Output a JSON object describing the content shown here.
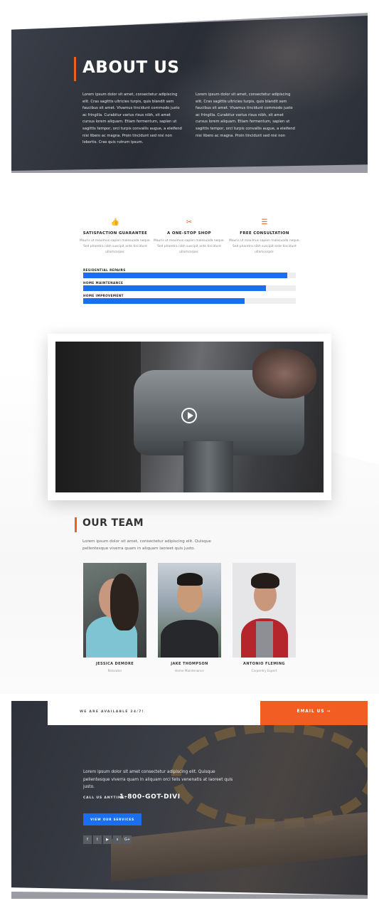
{
  "hero": {
    "title": "ABOUT US",
    "col1": "Lorem ipsum dolor sit amet, consectetur adipiscing elit. Cras sagittis ultricies turpis, quis blandit sem faucibus sit amet. Vivamus tincidunt commodo justo ac fringilla. Curabitur varius risus nibh, sit amet cursus lorem aliquam. Etiam fermentum, sapien ut sagittis tempor, orci turpis convallis augue, a eleifend nisi libero ac magna. Proin tincidunt sed nisi non lobortis. Cras quis rutrum ipsum.",
    "col2": "Lorem ipsum dolor sit amet, consectetur adipiscing elit. Cras sagittis ultricies turpis, quis blandit sem faucibus sit amet. Vivamus tincidunt commodo justo ac fringilla. Curabitur varius risus nibh, sit amet cursus lorem aliquam. Etiam fermentum, sapien ut sagittis tempor, orci turpis convallis augue, a eleifend nisi libero ac magna. Proin tincidunt sed nisi non"
  },
  "features": [
    {
      "icon": "thumbs-up-icon",
      "glyph": "👍",
      "title": "SATISFACTION GUARANTEE",
      "text": "Mauris ut maximus sapien malesuada neque. Sed pharetra nibh suscipit ante tincidunt ullamcorper."
    },
    {
      "icon": "tools-icon",
      "glyph": "✂",
      "title": "A ONE-STOP SHOP",
      "text": "Mauris ut maximus sapien malesuada neque. Sed pharetra nibh suscipit ante tincidunt ullamcorper."
    },
    {
      "icon": "document-icon",
      "glyph": "☰",
      "title": "FREE CONSULTATION",
      "text": "Mauris ut maximus sapien malesuada neque. Sed pharetra nibh suscipit ante tincidunt ullamcorper."
    }
  ],
  "skills": [
    {
      "label": "RESIDENTIAL REPAIRS",
      "percent": 96
    },
    {
      "label": "HOME MAINTENANCE",
      "percent": 86
    },
    {
      "label": "HOME IMPROVEMENT",
      "percent": 76
    }
  ],
  "video": {
    "play_icon": "play-icon"
  },
  "team": {
    "title": "OUR TEAM",
    "intro": "Lorem ipsum dolor sit amet, consectetur adipiscing elit. Quisque pellentesque viverra quam in aliquam laoreet quis justo.",
    "members": [
      {
        "name": "JESSICA DEMORE",
        "role": "Relocator"
      },
      {
        "name": "JAKE THOMPSON",
        "role": "Home Maintenance"
      },
      {
        "name": "ANTONIO FLEMING",
        "role": "Carpentry Expert"
      }
    ]
  },
  "contact": {
    "available": "WE ARE AVAILABLE 24/7!",
    "email_button": "EMAIL US →",
    "text": "Lorem ipsum dolor sit amet consectetur adipiscing elit. Quisque pellentesque viverra quam in aliquam orci felis venenatis at laoreet quis justo.",
    "call_label": "CALL US ANYTIME:",
    "phone": "1-800-GOT-DIVI",
    "services_button": "VIEW OUR SERVICES",
    "social": [
      {
        "icon": "facebook-icon",
        "glyph": "f"
      },
      {
        "icon": "twitter-icon",
        "glyph": "t"
      },
      {
        "icon": "youtube-icon",
        "glyph": "▶"
      },
      {
        "icon": "skype-icon",
        "glyph": "s"
      },
      {
        "icon": "google-plus-icon",
        "glyph": "G+"
      }
    ]
  },
  "colors": {
    "accent": "#f15d22",
    "primary": "#1a6ff0",
    "dark": "#2e3139"
  }
}
